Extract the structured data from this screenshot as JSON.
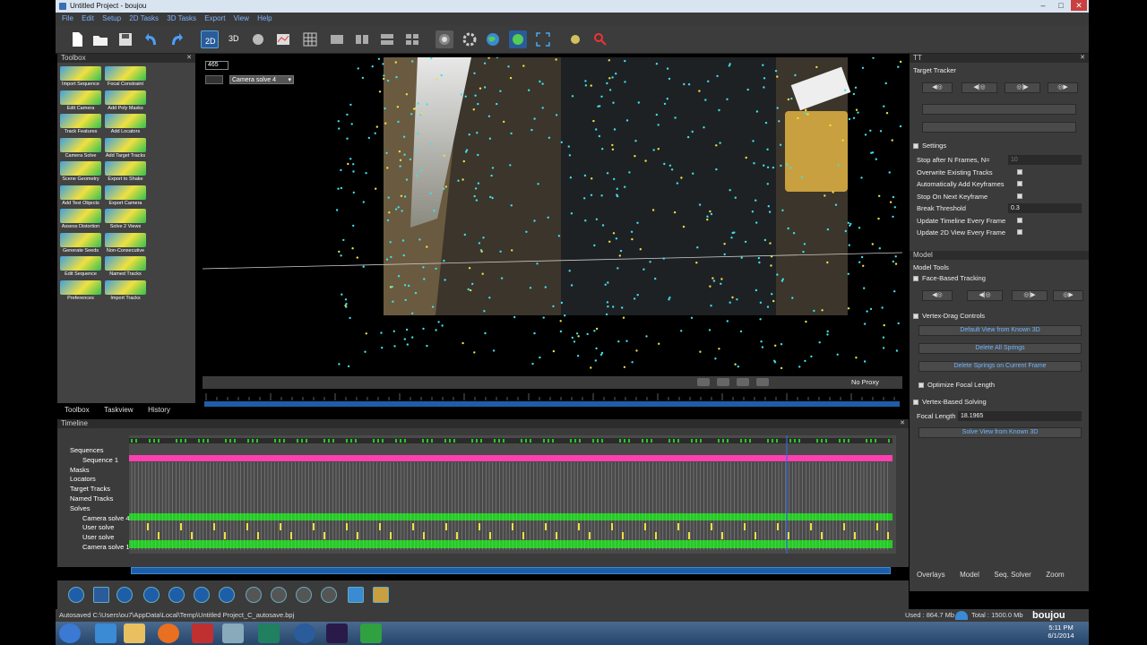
{
  "window": {
    "title": "Untitled Project - boujou"
  },
  "menu": [
    "File",
    "Edit",
    "Setup",
    "2D Tasks",
    "3D Tasks",
    "Export",
    "View",
    "Help"
  ],
  "toolbox": {
    "header": "Toolbox",
    "tools": [
      "Import Sequence",
      "Focal Constraint",
      "Edit Camera",
      "Add Poly Masks",
      "Track Features",
      "Add Locators",
      "Camera Solve",
      "Add Target Tracks",
      "Scene Geometry",
      "Export to Shake",
      "Add Test Objects",
      "Export Camera",
      "Assess Distortion",
      "Solve 2 Views",
      "Generate Seeds",
      "Non-Consecutive",
      "Edit Sequence",
      "Named Tracks",
      "Preferences",
      "Import Tracks"
    ],
    "tabs": [
      "Toolbox",
      "Taskview",
      "History"
    ]
  },
  "viewport": {
    "frame_number": "465",
    "camera_select": "Camera solve 4",
    "proxy_label": "No Proxy"
  },
  "timeline": {
    "header": "Timeline",
    "tree": [
      {
        "label": "Sequences",
        "indent": 0
      },
      {
        "label": "Sequence 1",
        "indent": 1
      },
      {
        "label": "Masks",
        "indent": 0
      },
      {
        "label": "Locators",
        "indent": 0
      },
      {
        "label": "Target Tracks",
        "indent": 0
      },
      {
        "label": "Named Tracks",
        "indent": 0
      },
      {
        "label": "Solves",
        "indent": 0
      },
      {
        "label": "Camera solve 4",
        "indent": 1
      },
      {
        "label": "User solve",
        "indent": 1
      },
      {
        "label": "User solve",
        "indent": 1
      },
      {
        "label": "Camera solve 1",
        "indent": 1
      }
    ],
    "bar_colors": [
      "#ff3fb0",
      "#22cc22"
    ]
  },
  "right_panel": {
    "tt_header": "TT",
    "target_tracker": "Target Tracker",
    "settings_label": "Settings",
    "settings": [
      {
        "label": "Stop after N Frames, N=",
        "value": "10"
      },
      {
        "label": "Overwrite Existing Tracks",
        "value": "checked"
      },
      {
        "label": "Automatically Add Keyframes",
        "value": "checked"
      },
      {
        "label": "Stop On Next Keyframe",
        "value": "checked"
      },
      {
        "label": "Break Threshold",
        "value": "0.3"
      },
      {
        "label": "Update Timeline Every Frame",
        "value": "checked"
      },
      {
        "label": "Update 2D View Every Frame",
        "value": "checked"
      }
    ],
    "model_header": "Model",
    "model_tools": "Model Tools",
    "face_based": "Face-Based Tracking",
    "vertex_drag": "Vertex-Drag Controls",
    "btn_default_view": "Default View from Known 3D",
    "btn_delete_springs": "Delete All Springs",
    "btn_delete_springs_frame": "Delete Springs on Current Frame",
    "optimize_focal": "Optimize Focal Length",
    "vertex_solving": "Vertex-Based Solving",
    "focal_label": "Focal Length",
    "focal_value": "18.1965",
    "btn_solve_view": "Solve View from Known 3D",
    "bottom_tabs": [
      "Overlays",
      "Model",
      "Seq. Solver",
      "Zoom"
    ]
  },
  "status": {
    "autosave": "Autosaved C:\\Users\\ou7\\AppData\\Local\\Temp\\Untitled Project_C_autosave.bpj",
    "used": "Used : 864.7 Mb",
    "total": "Total : 1500.0 Mb",
    "brand": "boujou"
  },
  "taskbar": {
    "time": "5:11 PM",
    "date": "6/1/2014"
  },
  "colors": {
    "accent": "#1e5ea8",
    "link": "#6fb5ff",
    "track_cyan": "#3fe0e8",
    "track_yellow": "#f0e040"
  }
}
